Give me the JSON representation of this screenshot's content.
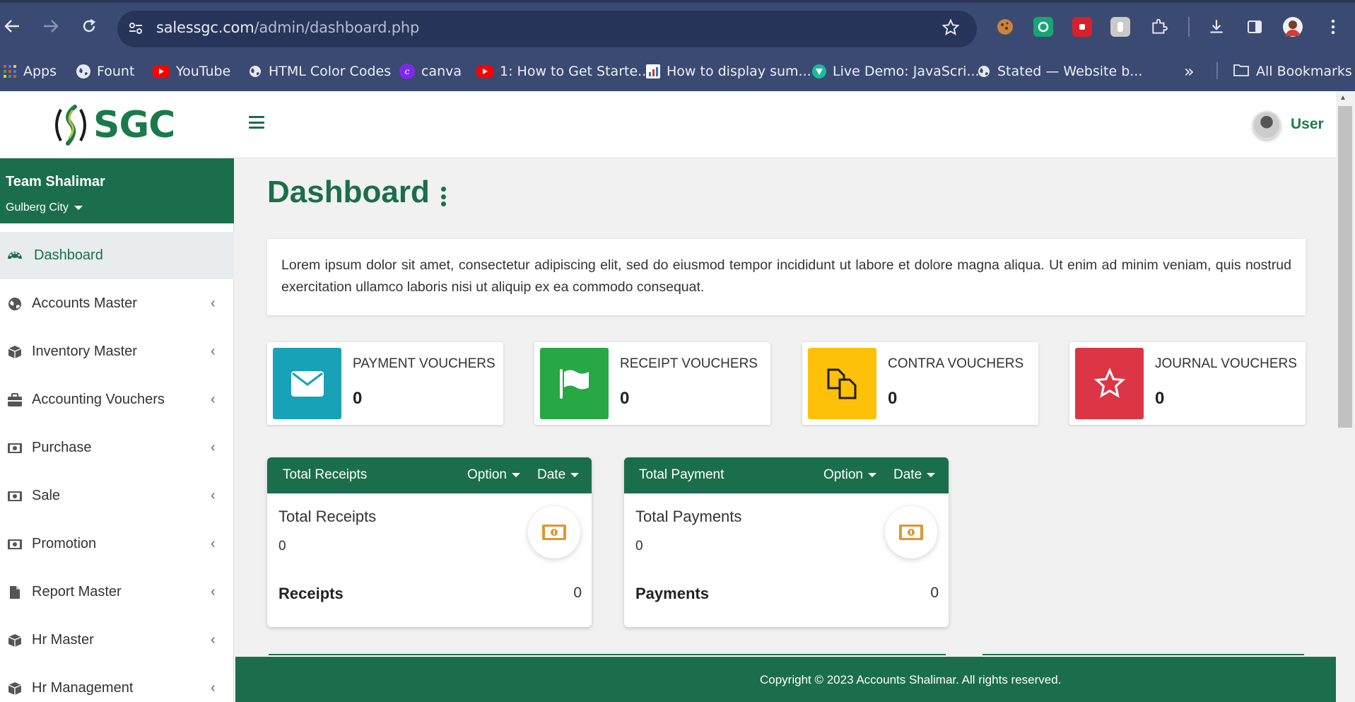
{
  "browser": {
    "url_domain": "salessgc.com",
    "url_path": "/admin/dashboard.php",
    "bookmarks": [
      {
        "label": "Apps",
        "icon": "apps-grid-icon"
      },
      {
        "label": "Fount",
        "icon": "globe-icon"
      },
      {
        "label": "YouTube",
        "icon": "youtube-icon"
      },
      {
        "label": "HTML Color Codes",
        "icon": "globe-icon"
      },
      {
        "label": "canva",
        "icon": "canva-icon"
      },
      {
        "label": "1: How to Get Starte...",
        "icon": "youtube-icon"
      },
      {
        "label": "How to display sum...",
        "icon": "chart-favicon"
      },
      {
        "label": "Live Demo: JavaScri...",
        "icon": "live-demo-favicon"
      },
      {
        "label": "Stated — Website b...",
        "icon": "globe-icon"
      }
    ],
    "overflow": "»",
    "all_bookmarks": "All Bookmarks"
  },
  "header": {
    "logo_text": "SGC",
    "user_label": "User"
  },
  "sidebar": {
    "team_name": "Team Shalimar",
    "team_city": "Gulberg City",
    "items": [
      {
        "label": "Dashboard",
        "icon": "palette-icon"
      },
      {
        "label": "Accounts Master",
        "icon": "globe-icon"
      },
      {
        "label": "Inventory Master",
        "icon": "cube-icon"
      },
      {
        "label": "Accounting Vouchers",
        "icon": "briefcase-icon"
      },
      {
        "label": "Purchase",
        "icon": "money-bill-icon"
      },
      {
        "label": "Sale",
        "icon": "money-bill-icon"
      },
      {
        "label": "Promotion",
        "icon": "money-bill-icon"
      },
      {
        "label": "Report Master",
        "icon": "file-icon"
      },
      {
        "label": "Hr Master",
        "icon": "cube-icon"
      },
      {
        "label": "Hr Management",
        "icon": "cube-icon"
      }
    ]
  },
  "main": {
    "title": "Dashboard",
    "intro": "Lorem ipsum dolor sit amet, consectetur adipiscing elit, sed do eiusmod tempor incididunt ut labore et dolore magna aliqua. Ut enim ad minim veniam, quis nostrud exercitation ullamco laboris nisi ut aliquip ex ea commodo consequat.",
    "info_boxes": [
      {
        "label": "PAYMENT VOUCHERS",
        "value": "0",
        "color": "#17a2b8",
        "icon": "envelope-icon"
      },
      {
        "label": "RECEIPT VOUCHERS",
        "value": "0",
        "color": "#28a745",
        "icon": "flag-icon"
      },
      {
        "label": "CONTRA VOUCHERS",
        "value": "0",
        "color": "#ffc107",
        "icon": "copy-icon"
      },
      {
        "label": "JOURNAL VOUCHERS",
        "value": "0",
        "color": "#dc3545",
        "icon": "star-icon"
      }
    ],
    "cards": [
      {
        "title": "Total Receipts",
        "option": "Option",
        "date": "Date",
        "subtitle": "Total Receipts",
        "amount": "0",
        "footer_label": "Receipts",
        "footer_value": "0"
      },
      {
        "title": "Total Payment",
        "option": "Option",
        "date": "Date",
        "subtitle": "Total Payments",
        "amount": "0",
        "footer_label": "Payments",
        "footer_value": "0"
      }
    ]
  },
  "footer": {
    "text": "Copyright © 2023 Accounts Shalimar. All rights reserved."
  },
  "colors": {
    "brand_green": "#1b6e4b",
    "chrome": "#3b4a72"
  }
}
